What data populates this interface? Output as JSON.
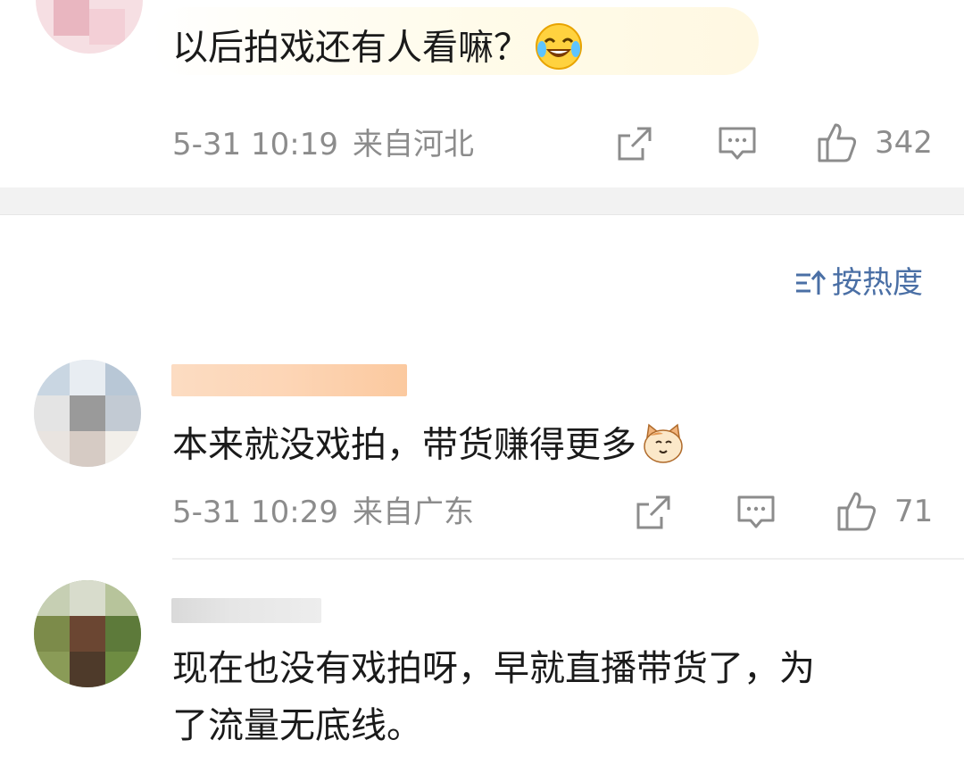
{
  "comments": [
    {
      "text": "以后拍戏还有人看嘛？",
      "emoji": "laughing-crying-emoji",
      "time": "5-31 10:19",
      "location": "来自河北",
      "likes": "342"
    },
    {
      "text": "本来就没戏拍，带货赚得更多",
      "emoji": "cat-face-emoji",
      "time": "5-31 10:29",
      "location": "来自广东",
      "likes": "71"
    },
    {
      "text_line1": "现在也没有戏拍呀，早就直播带货了，为",
      "text_line2": "了流量无底线。"
    }
  ],
  "sort": {
    "label": "按热度",
    "icon": "sort-icon"
  },
  "icons": {
    "share": "share-icon",
    "reply": "reply-icon",
    "like": "thumbs-up-icon"
  },
  "colors": {
    "text": "#1a1a1a",
    "meta": "#8c8c8c",
    "sort": "#4a6fa5",
    "band": "#f2f2f2"
  }
}
